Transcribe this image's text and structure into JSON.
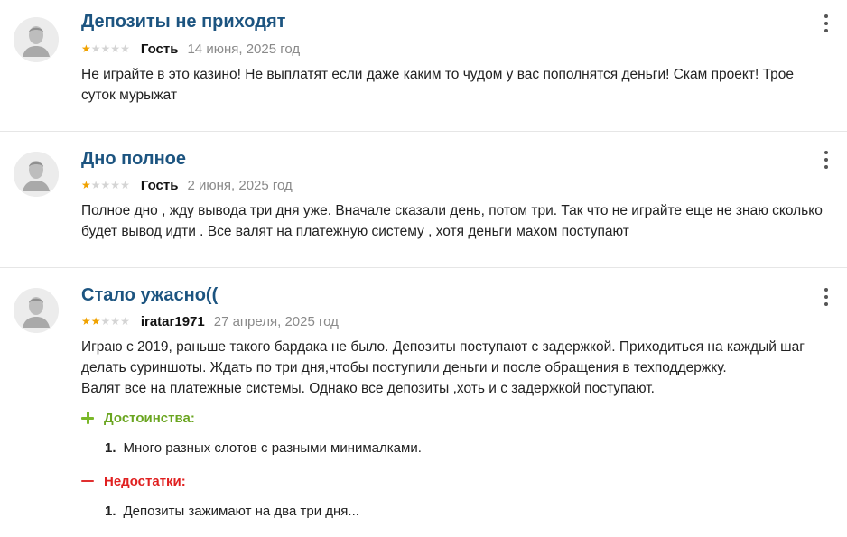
{
  "reviews": [
    {
      "title": "Депозиты не приходят",
      "rating": 1,
      "author": "Гость",
      "date": "14 июня, 2025 год",
      "text": [
        "Не играйте в это казино! Не выплатят если даже каким то чудом у вас пополнятся деньги! Скам проект! Трое суток мурыжат"
      ]
    },
    {
      "title": "Дно полное",
      "rating": 1,
      "author": "Гость",
      "date": "2 июня, 2025 год",
      "text": [
        "Полное дно , жду вывода три дня уже. Вначале сказали день, потом три. Так что не играйте еще не знаю сколько будет вывод идти . Все валят на платежную систему , хотя деньги махом поступают"
      ]
    },
    {
      "title": "Стало ужасно((",
      "rating": 2,
      "author": "iratar1971",
      "date": "27 апреля, 2025 год",
      "text": [
        "Играю с 2019, раньше такого бардака не было. Депозиты поступают с задержкой. Приходиться на каждый шаг делать суриншоты. Ждать по три дня,чтобы поступили деньги и после обращения в техподдержку.",
        "Валят все на платежные системы. Однако все депозиты ,хоть и с задержкой поступают."
      ],
      "pros_label": "Достоинства:",
      "pros": [
        {
          "num": "1.",
          "text": "Много разных слотов с разными минималками."
        }
      ],
      "cons_label": "Недостатки:",
      "cons": [
        {
          "num": "1.",
          "text": "Депозиты зажимают на два три дня..."
        }
      ]
    }
  ],
  "stars_max": 5,
  "colors": {
    "title": "#1c5480",
    "star_filled": "#f0a200",
    "star_empty": "#d4d4d4",
    "pros": "#6aa520",
    "cons": "#e02020",
    "date": "#8a8a8a"
  },
  "icons": {
    "avatar": "user-avatar-icon",
    "menu": "more-vertical-icon",
    "pros": "plus-icon",
    "cons": "minus-icon"
  }
}
